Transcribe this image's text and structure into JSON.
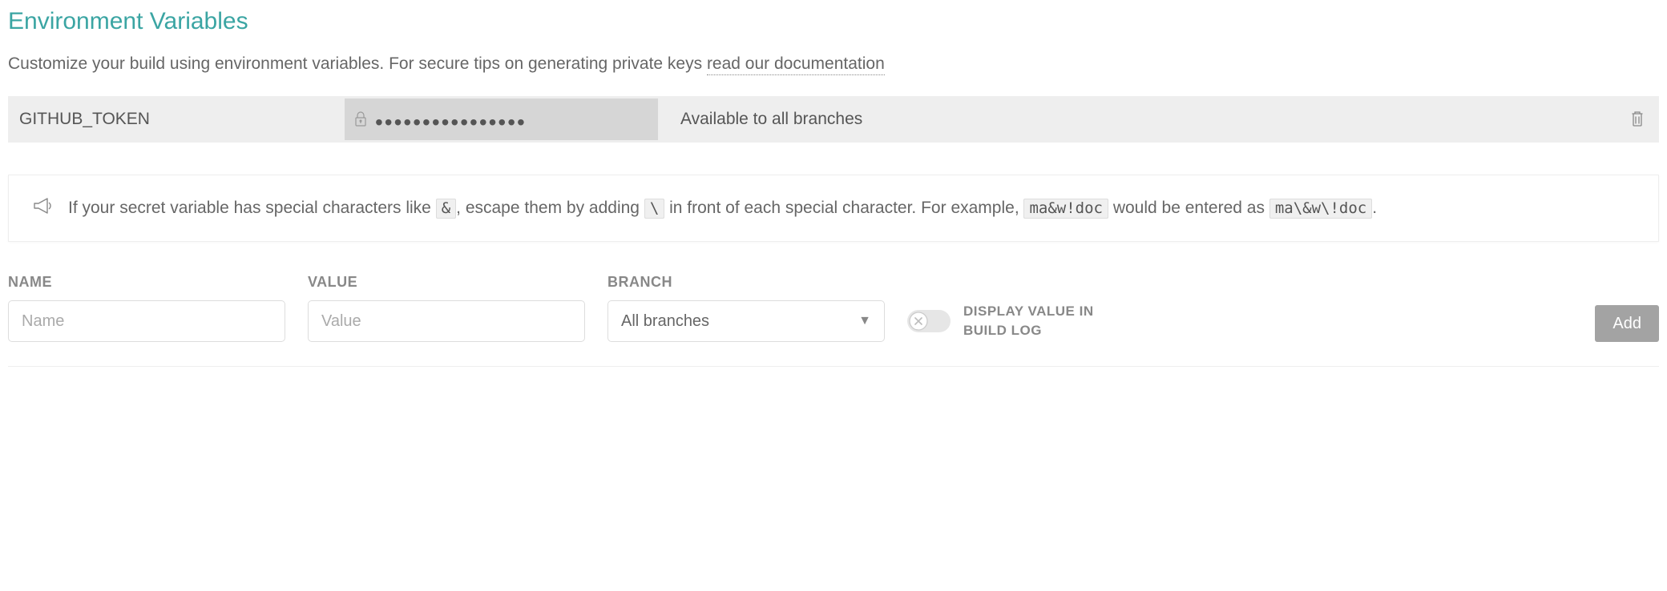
{
  "header": {
    "title": "Environment Variables",
    "subtitle_prefix": "Customize your build using environment variables. For secure tips on generating private keys ",
    "doc_link_text": "read our documentation"
  },
  "vars": [
    {
      "name": "GITHUB_TOKEN",
      "value_masked": "••••••••••••••••",
      "branch_text": "Available to all branches"
    }
  ],
  "callout": {
    "t1": "If your secret variable has special characters like ",
    "c1": "&",
    "t2": ", escape them by adding ",
    "c2": "\\",
    "t3": " in front of each special character. For example, ",
    "c3": "ma&w!doc",
    "t4": " would be entered as ",
    "c4": "ma\\&w\\!doc",
    "t5": "."
  },
  "form": {
    "name_label": "NAME",
    "name_placeholder": "Name",
    "value_label": "VALUE",
    "value_placeholder": "Value",
    "branch_label": "BRANCH",
    "branch_selected": "All branches",
    "toggle_label": "DISPLAY VALUE IN BUILD LOG",
    "add_label": "Add"
  }
}
